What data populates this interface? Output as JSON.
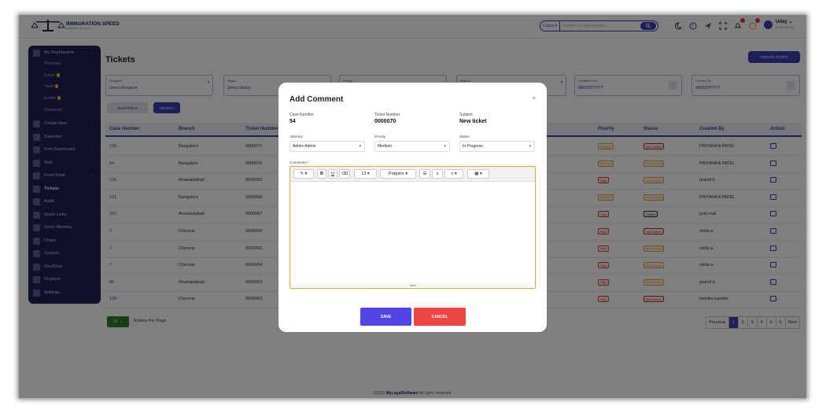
{
  "brand": {
    "name": "IMMIGRATION SPEED",
    "tagline": "POWERED BY MYLS"
  },
  "search": {
    "scope": "Cases",
    "placeholder": "Search by case number..."
  },
  "user": {
    "name": "Uday",
    "role": "Super Admin"
  },
  "sidebar": {
    "items": [
      {
        "label": "My Dashboards"
      },
      {
        "label": "Create New"
      },
      {
        "label": "Calendar"
      },
      {
        "label": "Firm Dashboard"
      },
      {
        "label": "Mail"
      },
      {
        "label": "Front Desk"
      },
      {
        "label": "Tickets"
      },
      {
        "label": "Audit"
      },
      {
        "label": "Quick Links"
      },
      {
        "label": "Zoom Meeting"
      },
      {
        "label": "Chats"
      },
      {
        "label": "Support"
      },
      {
        "label": "OneDrive"
      },
      {
        "label": "Dropbox"
      },
      {
        "label": "Settings"
      }
    ],
    "subitems": [
      {
        "label": "Overview"
      },
      {
        "label": "Cases",
        "count": "3"
      },
      {
        "label": "Tasks",
        "count": "5"
      },
      {
        "label": "Events",
        "count": "1"
      },
      {
        "label": "Timesheet"
      }
    ]
  },
  "page": {
    "title": "Tickets",
    "create_label": "CREATE TICKET"
  },
  "filters": {
    "assignee_label": "Assignee",
    "assignee_value": "Select Assignee",
    "status_label": "Status",
    "status_value": "Select Status",
    "priority_label": "Priority",
    "branch_label": "Branch",
    "created_from_label": "Created From",
    "created_from_value": "MM/DD/YYYY",
    "created_to_label": "Created To",
    "created_to_value": "MM/DD/YYYY",
    "reset_label": "Reset Filters",
    "search_label": "SEARCH"
  },
  "table": {
    "headers": {
      "case": "Case Number",
      "branch": "Branch",
      "ticket": "Ticket Number",
      "priority": "Priority",
      "status": "Status",
      "created_by": "Created By",
      "action": "Action"
    },
    "rows": [
      {
        "case": "130",
        "branch": "Bangalore",
        "ticket": "0000071",
        "priority": "Medium",
        "status": "Not Solved",
        "created_by": "PRIYANKA PATEL"
      },
      {
        "case": "54",
        "branch": "Bangalore",
        "ticket": "0000070",
        "priority": "Medium",
        "status": "In Progress",
        "created_by": "PRIYANKA PATEL"
      },
      {
        "case": "125",
        "branch": "Ahamadabad",
        "ticket": "0000069",
        "priority": "High",
        "status": "In Progress",
        "created_by": "pramit b"
      },
      {
        "case": "121",
        "branch": "Bangalore",
        "ticket": "0000068",
        "priority": "Medium",
        "status": "In Progress",
        "created_by": "PRIYANKA PATEL"
      },
      {
        "case": "107",
        "branch": "Ahamadabad",
        "ticket": "0000067",
        "priority": "High",
        "status": "Solved",
        "created_by": "jyoti mali"
      },
      {
        "case": "7",
        "branch": "Chennai",
        "ticket": "0000066",
        "priority": "High",
        "status": "Not Solved",
        "created_by": "stella a"
      },
      {
        "case": "7",
        "branch": "Chennai",
        "ticket": "0000065",
        "priority": "High",
        "status": "In Progress",
        "created_by": "stella a"
      },
      {
        "case": "7",
        "branch": "Chennai",
        "ticket": "0000064",
        "priority": "High",
        "status": "In Progress",
        "created_by": "stella a"
      },
      {
        "case": "86",
        "branch": "Ahamadabad",
        "ticket": "0000063",
        "priority": "High",
        "status": "In Progress",
        "created_by": "pramit b"
      },
      {
        "case": "108",
        "branch": "Chennai",
        "ticket": "0000062",
        "priority": "High",
        "status": "Not Solved",
        "created_by": "monika kamble"
      }
    ]
  },
  "pagination": {
    "per_page": "10",
    "per_page_label": "Entries Per Page",
    "previous": "Previous",
    "next": "Next",
    "pages": [
      "1",
      "2",
      "3",
      "4",
      "5",
      "6"
    ],
    "current": "1"
  },
  "footer": {
    "prefix": "©2025 ",
    "brand": "MyLegalSoftware",
    "suffix": " All rights reserved."
  },
  "modal": {
    "title": "Add Comment",
    "close": "×",
    "case_label": "Case Number",
    "case_value": "54",
    "ticket_label": "Ticket Number",
    "ticket_value": "0000070",
    "subject_label": "Subject",
    "subject_value": "New ticket",
    "attorney_label": "Attorney",
    "attorney_value": "Admin Admin",
    "priority_label": "Priority",
    "priority_value": "Medium",
    "status_label": "Status",
    "status_value": "In Progress",
    "comments_label": "Comments *",
    "toolbar": {
      "bold": "B",
      "underline": "U",
      "font_size": "13",
      "font_family": "Poppins"
    },
    "save_label": "SAVE",
    "cancel_label": "CANCEL"
  },
  "colors": {
    "accent": "#3c3cb3",
    "sidebar": "#1e2254",
    "save": "#4f46e5",
    "cancel": "#ef4444",
    "editor_border": "#e8a63f"
  }
}
